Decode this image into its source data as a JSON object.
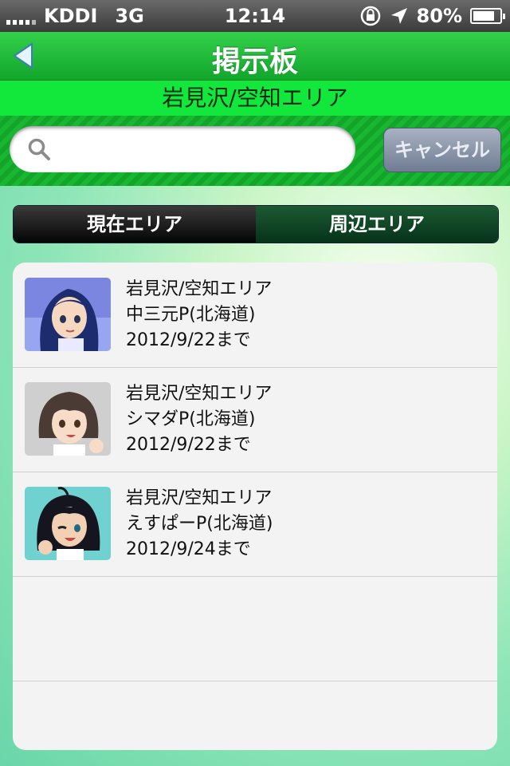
{
  "status_bar": {
    "carrier": "KDDI",
    "network": "3G",
    "time": "12:14",
    "battery": "80%",
    "battery_level": 0.8
  },
  "navbar": {
    "title": "掲示板"
  },
  "area_label": "岩見沢/空知エリア",
  "search": {
    "placeholder": "",
    "cancel_label": "キャンセル"
  },
  "segments": {
    "current_area": "現在エリア",
    "nearby_area": "周辺エリア"
  },
  "posts": [
    {
      "area": "岩見沢/空知エリア",
      "user": "中三元P(北海道)",
      "until": "2012/9/22まで"
    },
    {
      "area": "岩見沢/空知エリア",
      "user": "シマダP(北海道)",
      "until": "2012/9/22まで"
    },
    {
      "area": "岩見沢/空知エリア",
      "user": "えすぱーP(北海道)",
      "until": "2012/9/24まで"
    }
  ]
}
